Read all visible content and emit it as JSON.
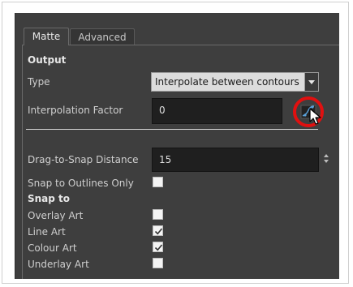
{
  "tabs": [
    {
      "label": "Matte",
      "active": true
    },
    {
      "label": "Advanced",
      "active": false
    }
  ],
  "output": {
    "title": "Output",
    "type_label": "Type",
    "type_value": "Interpolate between contours",
    "interp_label": "Interpolation Factor",
    "interp_value": "0"
  },
  "snap_distance": {
    "label": "Drag-to-Snap Distance",
    "value": "15"
  },
  "snap_outlines": {
    "label": "Snap to Outlines Only",
    "checked": false
  },
  "snap_to": {
    "title": "Snap to",
    "items": [
      {
        "label": "Overlay Art",
        "checked": false
      },
      {
        "label": "Line Art",
        "checked": true
      },
      {
        "label": "Colour Art",
        "checked": true
      },
      {
        "label": "Underlay Art",
        "checked": false
      }
    ]
  },
  "colors": {
    "panel_bg": "#3e3e3e",
    "field_bg": "#1f1f1f",
    "highlight_ring": "#e01010"
  },
  "icons": [
    "dropdown-arrow-icon",
    "function-curve-icon",
    "mouse-cursor-icon",
    "spinner-arrows-icon",
    "checkmark-icon"
  ]
}
